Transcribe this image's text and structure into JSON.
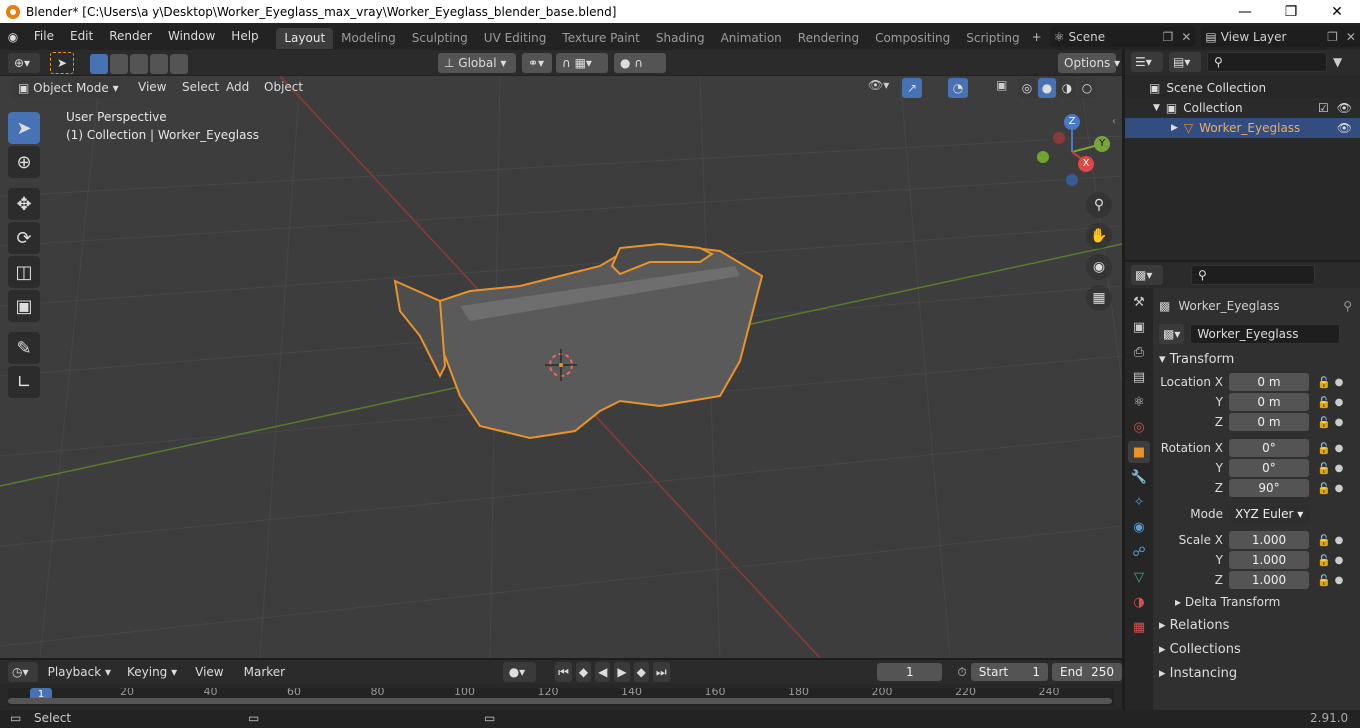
{
  "window": {
    "title": "Blender* [C:\\Users\\a y\\Desktop\\Worker_Eyeglass_max_vray\\Worker_Eyeglass_blender_base.blend]",
    "min_icon": "minimize-icon",
    "max_icon": "maximize-icon",
    "close_icon": "close-icon"
  },
  "menu": [
    "File",
    "Edit",
    "Render",
    "Window",
    "Help"
  ],
  "workspaces": [
    "Layout",
    "Modeling",
    "Sculpting",
    "UV Editing",
    "Texture Paint",
    "Shading",
    "Animation",
    "Rendering",
    "Compositing",
    "Scripting"
  ],
  "active_workspace": "Layout",
  "scene": {
    "label": "Scene",
    "view_layer": "View Layer"
  },
  "header": {
    "orientation": "Global",
    "options": "Options"
  },
  "viewport_header": {
    "mode": "Object Mode",
    "view": "View",
    "select": "Select",
    "add": "Add",
    "object": "Object"
  },
  "viewport": {
    "perspective": "User Perspective",
    "collection_info": "(1) Collection | Worker_Eyeglass"
  },
  "gizmo": {
    "z": "Z",
    "y": "Y",
    "x": "X"
  },
  "outliner": {
    "scene_collection": "Scene Collection",
    "collection": "Collection",
    "object": "Worker_Eyeglass"
  },
  "properties": {
    "object_name": "Worker_Eyeglass",
    "data_name": "Worker_Eyeglass",
    "transform": "Transform",
    "location_label": "Location X",
    "rotation_label": "Rotation X",
    "scale_label": "Scale X",
    "y": "Y",
    "z": "Z",
    "location": [
      "0 m",
      "0 m",
      "0 m"
    ],
    "rotation": [
      "0°",
      "0°",
      "90°"
    ],
    "mode_label": "Mode",
    "mode_value": "XYZ Euler",
    "scale": [
      "1.000",
      "1.000",
      "1.000"
    ],
    "delta": "Delta Transform",
    "relations": "Relations",
    "collections": "Collections",
    "instancing": "Instancing"
  },
  "timeline": {
    "playback": "Playback",
    "keying": "Keying",
    "view": "View",
    "marker": "Marker",
    "current_frame": "1",
    "start_label": "Start",
    "start": "1",
    "end_label": "End",
    "end": "250",
    "ticks": [
      "1",
      "20",
      "40",
      "60",
      "80",
      "100",
      "120",
      "140",
      "160",
      "180",
      "200",
      "220",
      "240"
    ]
  },
  "status": {
    "select": "Select",
    "version": "2.91.0"
  },
  "colors": {
    "accent": "#4772b3",
    "selection": "#e8942a",
    "x_axis": "#c53b3b",
    "y_axis": "#6c9b2e"
  }
}
